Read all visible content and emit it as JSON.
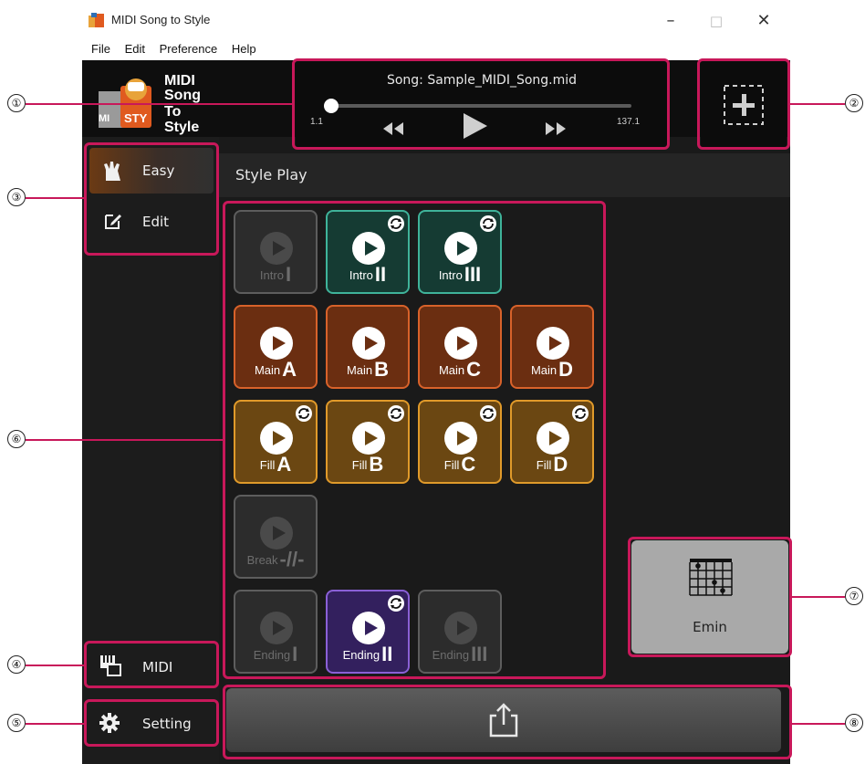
{
  "window": {
    "title": "MIDI Song to Style",
    "minimize_glyph": "–",
    "maximize_glyph": "□",
    "close_glyph": "✕"
  },
  "menu": [
    "File",
    "Edit",
    "Preference",
    "Help"
  ],
  "logo": {
    "line1": "MIDI",
    "line2": "Song",
    "line3": "To",
    "line4": "Style",
    "badge_left": "MI",
    "badge_right": "STY"
  },
  "player": {
    "song": "Song: Sample_MIDI_Song.mid",
    "start": "1.1",
    "end": "137.1",
    "progress_fraction": 0.0
  },
  "modes": {
    "easy": "Easy",
    "edit": "Edit",
    "midi": "MIDI",
    "setting": "Setting"
  },
  "panel": {
    "title": "Style Play"
  },
  "style_buttons": [
    {
      "label": "Intro",
      "numeral": "I",
      "state": "disabled",
      "loop": false
    },
    {
      "label": "Intro",
      "numeral": "II",
      "state": "intro",
      "loop": true
    },
    {
      "label": "Intro",
      "numeral": "III",
      "state": "intro",
      "loop": true
    },
    {
      "label": "Main",
      "numeral": "A",
      "state": "main",
      "loop": false
    },
    {
      "label": "Main",
      "numeral": "B",
      "state": "main",
      "loop": false
    },
    {
      "label": "Main",
      "numeral": "C",
      "state": "main",
      "loop": false
    },
    {
      "label": "Main",
      "numeral": "D",
      "state": "main",
      "loop": false
    },
    {
      "label": "Fill",
      "numeral": "A",
      "state": "fill",
      "loop": true
    },
    {
      "label": "Fill",
      "numeral": "B",
      "state": "fill",
      "loop": true
    },
    {
      "label": "Fill",
      "numeral": "C",
      "state": "fill",
      "loop": true
    },
    {
      "label": "Fill",
      "numeral": "D",
      "state": "fill",
      "loop": true
    },
    {
      "label": "Break",
      "numeral": "-//-",
      "state": "disabled",
      "loop": false
    },
    {
      "label": "Ending",
      "numeral": "I",
      "state": "disabled",
      "loop": false
    },
    {
      "label": "Ending",
      "numeral": "II",
      "state": "ending",
      "loop": true
    },
    {
      "label": "Ending",
      "numeral": "III",
      "state": "disabled",
      "loop": false
    }
  ],
  "chord": {
    "name": "Emin"
  },
  "callouts": [
    "①",
    "②",
    "③",
    "④",
    "⑤",
    "⑥",
    "⑦",
    "⑧"
  ],
  "colors": {
    "highlight": "#c8185a",
    "intro": "#3fb39a",
    "main": "#d8622a",
    "fill": "#e09a2a",
    "ending": "#8a60d6"
  },
  "icons": {
    "app": "app-icon",
    "easy": "hand-icon",
    "edit": "edit-icon",
    "midi": "keyboard-icon",
    "setting": "gear-icon",
    "add": "add-icon",
    "export": "share-icon",
    "chord": "chord-grid-icon",
    "loop": "loop-icon"
  }
}
